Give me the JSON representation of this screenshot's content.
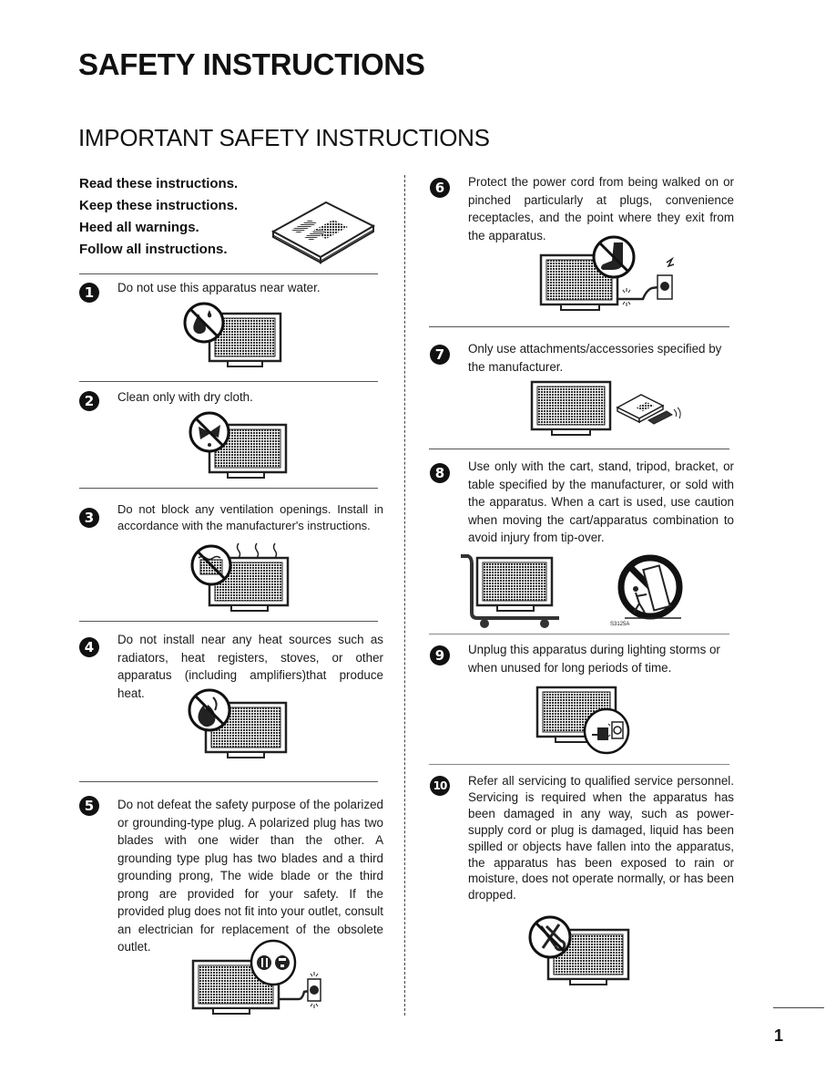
{
  "page": {
    "title": "SAFETY INSTRUCTIONS",
    "subtitle": "IMPORTANT SAFETY INSTRUCTIONS",
    "page_number": "1"
  },
  "intro": {
    "lines": [
      "Read these instructions.",
      "Keep these instructions.",
      "Heed all warnings.",
      "Follow all instructions."
    ],
    "illustration": "manual-book-icon"
  },
  "instructions": [
    {
      "number": "1",
      "text": "Do not use this apparatus near water.",
      "illustration": "no-water-tv-icon"
    },
    {
      "number": "2",
      "text": "Clean only with dry cloth.",
      "illustration": "no-wet-cloth-tv-icon"
    },
    {
      "number": "3",
      "text": "Do not block any ventilation openings. Install in accordance with the manufacturer's instructions.",
      "illustration": "no-blocked-vents-tv-icon"
    },
    {
      "number": "4",
      "text": "Do not install near any heat sources such as radiators, heat registers, stoves, or other apparatus (including amplifiers)that produce heat.",
      "illustration": "no-heat-tv-icon"
    },
    {
      "number": "5",
      "text": "Do not defeat the safety purpose of the polarized or grounding-type plug. A polarized plug has two blades with one wider than the other. A grounding type plug has two blades and a third grounding prong, The wide blade or the third prong are provided for your safety. If the provided plug does not fit into your outlet, consult an electrician for replacement of the obsolete outlet.",
      "illustration": "polarized-plug-tv-icon"
    },
    {
      "number": "6",
      "text": "Protect the power cord from being walked on or pinched particularly at plugs, convenience receptacles, and the point where they exit from the apparatus.",
      "illustration": "no-stepping-cord-tv-icon"
    },
    {
      "number": "7",
      "text": "Only use attachments/accessories specified by the manufacturer.",
      "illustration": "tv-accessories-icon"
    },
    {
      "number": "8",
      "text": "Use only with the cart, stand, tripod, bracket, or table specified by the manufacturer, or sold with the apparatus. When a cart is used, use caution when moving the cart/apparatus combination to avoid injury from tip-over.",
      "illustration": "cart-tip-over-warning-icon",
      "label": "S3125A"
    },
    {
      "number": "9",
      "text": "Unplug this apparatus during lighting storms or when unused for long periods of time.",
      "illustration": "unplug-tv-icon"
    },
    {
      "number": "10",
      "text": "Refer all servicing to qualified service personnel. Servicing is required when the apparatus has been damaged in any way, such as power-supply cord or plug is damaged, liquid has been spilled or objects have fallen into the apparatus, the apparatus has been exposed to rain or moisture, does not operate normally, or has been dropped.",
      "illustration": "no-self-repair-tv-icon"
    }
  ],
  "colors": {
    "text": "#111111",
    "badge": "#111111",
    "rule": "#555555",
    "screen": "#3a3a3a"
  }
}
